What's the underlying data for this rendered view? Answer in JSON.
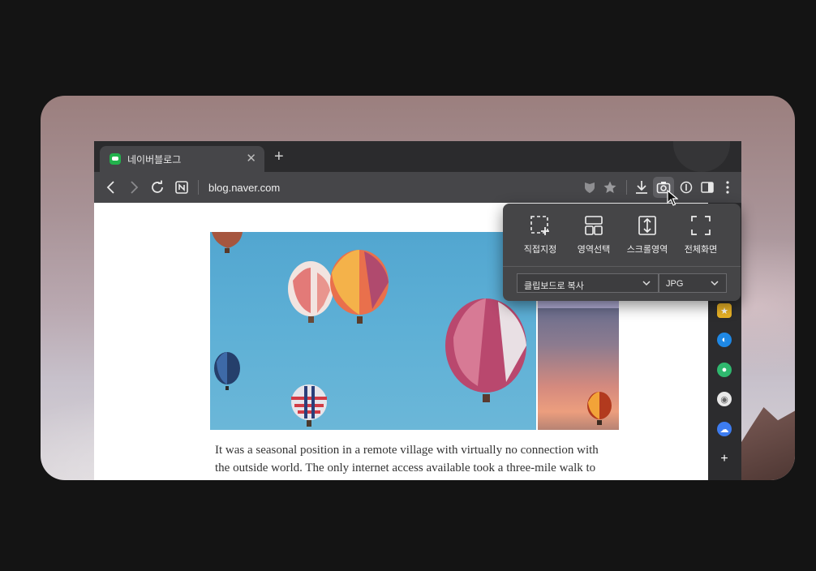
{
  "browser": {
    "tab": {
      "title": "네이버블로그",
      "close": "✕"
    },
    "new_tab": "+",
    "toolbar": {
      "url": "blog.naver.com",
      "icons": [
        "back-icon",
        "forward-icon",
        "reload-icon",
        "naver-icon",
        "shield-icon",
        "star-icon",
        "download-icon",
        "camera-icon",
        "reader-icon",
        "sidebar-icon",
        "more-icon"
      ]
    }
  },
  "capture_menu": {
    "options": [
      {
        "label": "직접지정",
        "icon": "custom-area-icon"
      },
      {
        "label": "영역선택",
        "icon": "region-select-icon"
      },
      {
        "label": "스크롤영역",
        "icon": "scroll-area-icon"
      },
      {
        "label": "전체화면",
        "icon": "fullscreen-icon"
      }
    ],
    "action_select": "클립보드로 복사",
    "format_select": "JPG"
  },
  "article": {
    "line1": "It was a seasonal position in a remote village with virtually no connection with",
    "line2": "the outside world. The only internet access available took a three-mile walk to"
  },
  "sidebar_icons": [
    "bookmark-icon",
    "whale-icon",
    "notification-icon",
    "chat-icon",
    "cloud-icon",
    "add-icon"
  ],
  "colors": {
    "naver_green": "#22b24c",
    "popup_bg": "#454547",
    "toolbar_bg": "#464649"
  }
}
